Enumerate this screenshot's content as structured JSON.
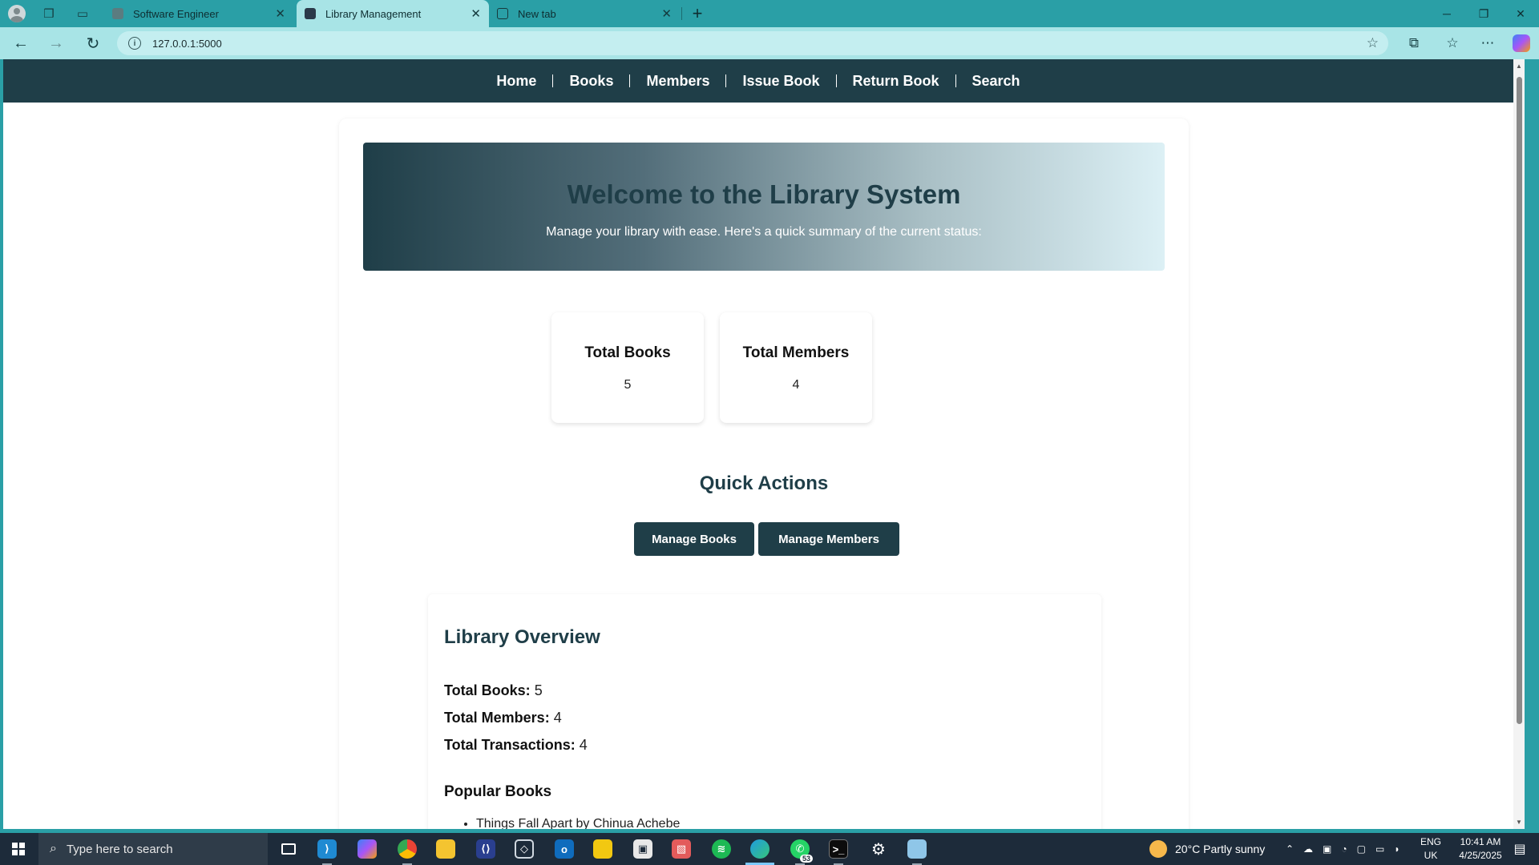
{
  "browser": {
    "tabs": [
      {
        "title": "Software Engineer"
      },
      {
        "title": "Library Management"
      },
      {
        "title": "New tab"
      }
    ],
    "url": "127.0.0.1:5000"
  },
  "site": {
    "nav": [
      "Home",
      "Books",
      "Members",
      "Issue Book",
      "Return Book",
      "Search"
    ],
    "hero": {
      "title": "Welcome to the Library System",
      "subtitle": "Manage your library with ease. Here's a quick summary of the current status:"
    },
    "stats": [
      {
        "label": "Total Books",
        "value": "5"
      },
      {
        "label": "Total Members",
        "value": "4"
      }
    ],
    "quick_actions": {
      "title": "Quick Actions",
      "buttons": [
        "Manage Books",
        "Manage Members"
      ]
    },
    "overview": {
      "title": "Library Overview",
      "lines": [
        {
          "label": "Total Books:",
          "value": "5"
        },
        {
          "label": "Total Members:",
          "value": "4"
        },
        {
          "label": "Total Transactions:",
          "value": "4"
        }
      ],
      "popular_title": "Popular Books",
      "popular_books": [
        "Things Fall Apart by Chinua Achebe"
      ]
    }
  },
  "taskbar": {
    "search_placeholder": "Type here to search",
    "whatsapp_badge": "53",
    "weather": "20°C  Partly sunny",
    "lang": "ENG",
    "region": "UK",
    "time": "10:41 AM",
    "date": "4/25/2025"
  },
  "colors": {
    "browser_frame": "#2a9fa6",
    "site_nav": "#1f3e48",
    "accent": "#1f3e48"
  }
}
